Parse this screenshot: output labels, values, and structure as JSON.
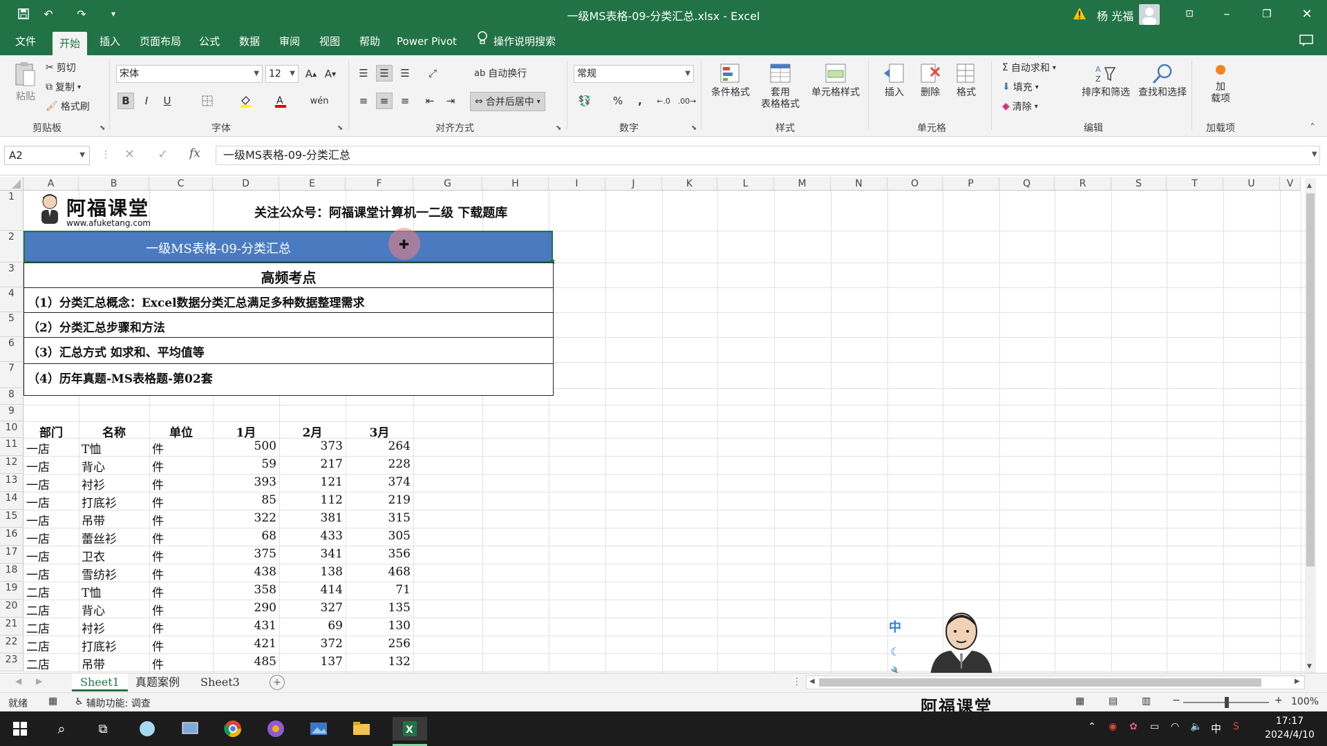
{
  "title_bar": {
    "title": "一级MS表格-09-分类汇总.xlsx  -  Excel",
    "user_name": "杨 光福"
  },
  "menu": {
    "tabs": [
      "文件",
      "开始",
      "插入",
      "页面布局",
      "公式",
      "数据",
      "审阅",
      "视图",
      "帮助",
      "Power Pivot"
    ],
    "active": "开始",
    "tell_me": "操作说明搜索"
  },
  "ribbon": {
    "clipboard": {
      "paste": "粘贴",
      "cut": "剪切",
      "copy": "复制",
      "format_painter": "格式刷",
      "label": "剪贴板"
    },
    "font": {
      "name": "宋体",
      "size": "12",
      "label": "字体"
    },
    "alignment": {
      "wrap": "自动换行",
      "merge": "合并后居中",
      "label": "对齐方式"
    },
    "number": {
      "format": "常规",
      "label": "数字"
    },
    "styles": {
      "conditional": "条件格式",
      "table_fmt_1": "套用",
      "table_fmt_2": "表格格式",
      "cell_styles": "单元格样式",
      "label": "样式"
    },
    "cells": {
      "insert": "插入",
      "delete": "删除",
      "format": "格式",
      "label": "单元格"
    },
    "editing": {
      "autosum": "自动求和",
      "fill": "填充",
      "clear": "清除",
      "sort": "排序和筛选",
      "find": "查找和选择",
      "label": "编辑"
    },
    "addins": {
      "line1": "加",
      "line2": "载项",
      "label": "加载项"
    }
  },
  "formula_bar": {
    "name_box": "A2",
    "content": "一级MS表格-09-分类汇总"
  },
  "columns": [
    "A",
    "B",
    "C",
    "D",
    "E",
    "F",
    "G",
    "H",
    "I",
    "J",
    "K",
    "L",
    "M",
    "N",
    "O",
    "P",
    "Q",
    "R",
    "S",
    "T",
    "U",
    "V"
  ],
  "rows": [
    "1",
    "2",
    "3",
    "4",
    "5",
    "6",
    "7",
    "8",
    "9",
    "10",
    "11",
    "12",
    "13",
    "14",
    "15",
    "16",
    "17",
    "18",
    "19",
    "20",
    "21",
    "22",
    "23"
  ],
  "sheet": {
    "logo_title": "阿福课堂",
    "logo_url": "www.afuketang.com",
    "header_note": "关注公众号：阿福课堂计算机一二级  下载题库",
    "banner": "一级MS表格-09-分类汇总",
    "section_title": "高频考点",
    "points": [
      "（1）分类汇总概念：Excel数据分类汇总满足多种数据整理需求",
      "（2）分类汇总步骤和方法",
      "（3）汇总方式 如求和、平均值等",
      "（4）历年真题-MS表格题-第02套"
    ],
    "table_headers": [
      "部门",
      "名称",
      "单位",
      "1月",
      "2月",
      "3月"
    ],
    "table_rows": [
      [
        "一店",
        "T恤",
        "件",
        "500",
        "373",
        "264"
      ],
      [
        "一店",
        "背心",
        "件",
        "59",
        "217",
        "228"
      ],
      [
        "一店",
        "衬衫",
        "件",
        "393",
        "121",
        "374"
      ],
      [
        "一店",
        "打底衫",
        "件",
        "85",
        "112",
        "219"
      ],
      [
        "一店",
        "吊带",
        "件",
        "322",
        "381",
        "315"
      ],
      [
        "一店",
        "蕾丝衫",
        "件",
        "68",
        "433",
        "305"
      ],
      [
        "一店",
        "卫衣",
        "件",
        "375",
        "341",
        "356"
      ],
      [
        "一店",
        "雪纺衫",
        "件",
        "438",
        "138",
        "468"
      ],
      [
        "二店",
        "T恤",
        "件",
        "358",
        "414",
        "71"
      ],
      [
        "二店",
        "背心",
        "件",
        "290",
        "327",
        "135"
      ],
      [
        "二店",
        "衬衫",
        "件",
        "431",
        "69",
        "130"
      ],
      [
        "二店",
        "打底衫",
        "件",
        "421",
        "372",
        "256"
      ],
      [
        "二店",
        "吊带",
        "件",
        "485",
        "137",
        "132"
      ]
    ]
  },
  "sheet_tabs": [
    "Sheet1",
    "真题案例",
    "Sheet3"
  ],
  "status": {
    "ready": "就绪",
    "accessibility": "辅助功能: 调查",
    "zoom": "100%"
  },
  "watermark": {
    "brand": "阿福课堂",
    "ime": "中"
  },
  "taskbar": {
    "time": "17:17",
    "date": "2024/4/10",
    "ime": "中"
  },
  "colors": {
    "excel_green": "#217346",
    "banner_blue": "#4a7bc0"
  }
}
